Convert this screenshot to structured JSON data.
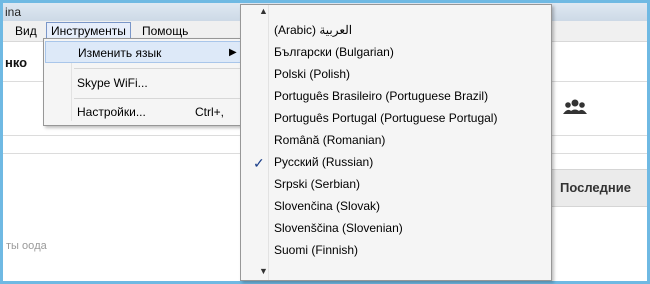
{
  "window": {
    "title_fragment": "ina"
  },
  "menubar": {
    "items": [
      "Вид",
      "Инструменты",
      "Помощь"
    ],
    "open_menu": "Инструменты"
  },
  "background": {
    "left_truncated": "нко",
    "faded_text": "ты ooда",
    "recent_tab": "Последние",
    "contacts_icon": "people-icon"
  },
  "tools_menu": {
    "items": [
      {
        "label": "Изменить язык",
        "has_submenu": true
      },
      {
        "label": "Skype WiFi..."
      },
      {
        "label": "Настройки...",
        "shortcut": "Ctrl+,"
      }
    ]
  },
  "language_menu": {
    "scroll_up_icon": "triangle-up-icon",
    "scroll_down_icon": "triangle-down-icon",
    "selected": "Русский (Russian)",
    "items": [
      "العربية (Arabic)",
      "Български (Bulgarian)",
      "Polski (Polish)",
      "Português Brasileiro (Portuguese Brazil)",
      "Português Portugal (Portuguese Portugal)",
      "Română (Romanian)",
      "Русский (Russian)",
      "Srpski (Serbian)",
      "Slovenčina (Slovak)",
      "Slovenščina (Slovenian)",
      "Suomi (Finnish)"
    ]
  },
  "colors": {
    "frame": "#6fb9e3",
    "highlight": "#dde9f8",
    "check": "#1b3f8a"
  }
}
